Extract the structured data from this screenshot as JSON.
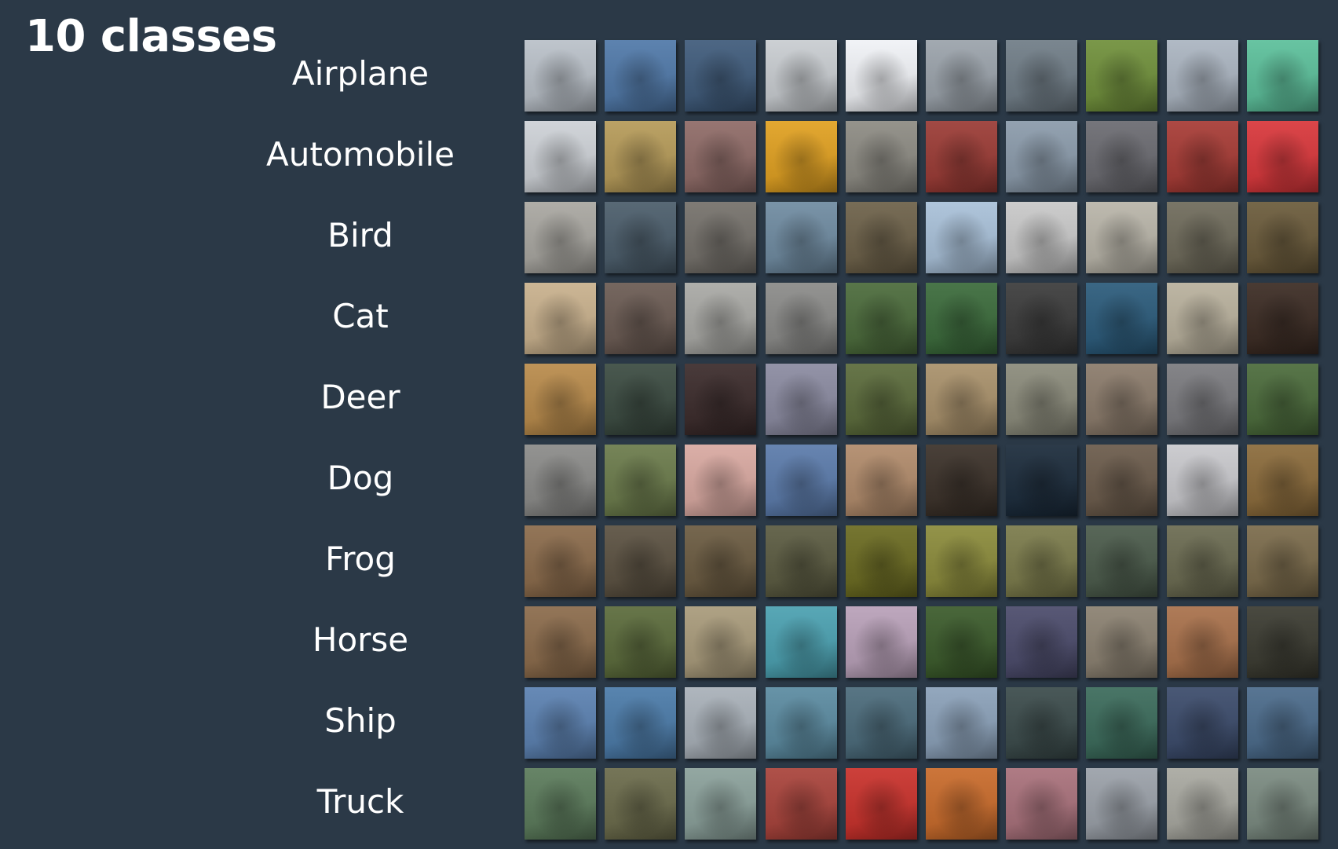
{
  "title": "10 classes",
  "classes": [
    {
      "label": "Airplane",
      "colors": [
        "#b9c0c8",
        "#4f78a8",
        "#3e5a7a",
        "#c8ccd0",
        "#f0f2f6",
        "#9aa2aa",
        "#6f7c86",
        "#6f8f3a",
        "#aab4c0",
        "#5bbf9a"
      ]
    },
    {
      "label": "Automobile",
      "colors": [
        "#cdd1d6",
        "#b59a58",
        "#8e6a66",
        "#e0a020",
        "#8c8a82",
        "#9a3a34",
        "#8a9aaa",
        "#6a6a70",
        "#a63a34",
        "#d8363a"
      ]
    },
    {
      "label": "Bird",
      "colors": [
        "#a8a6a0",
        "#4a5c6a",
        "#74706a",
        "#6e8aa0",
        "#6c6048",
        "#a8c0d8",
        "#c8c8c8",
        "#b8b4a8",
        "#6e6a5a",
        "#6a5a3a"
      ]
    },
    {
      "label": "Cat",
      "colors": [
        "#c8b08c",
        "#6a5a52",
        "#a8a8a4",
        "#8a8a88",
        "#4a6a3a",
        "#3a6a3a",
        "#3a3a3a",
        "#2a5a7a",
        "#b8b09c",
        "#3a2a22"
      ]
    },
    {
      "label": "Deer",
      "colors": [
        "#b88a4a",
        "#3a4a40",
        "#3a2a2a",
        "#8a8aa0",
        "#5a6a3a",
        "#a8906a",
        "#8a8a7a",
        "#8a7a6a",
        "#7a7a7e",
        "#4a6a3a"
      ]
    },
    {
      "label": "Dog",
      "colors": [
        "#8a8a88",
        "#6a7a4a",
        "#d8a8a0",
        "#5a7aaa",
        "#b08a6a",
        "#3a3028",
        "#1a2a3a",
        "#6a5a4a",
        "#c8c8cc",
        "#8a6a3a"
      ]
    },
    {
      "label": "Frog",
      "colors": [
        "#8a6a4a",
        "#5a5040",
        "#6a5a40",
        "#5a5a40",
        "#6a6a20",
        "#8a8a3a",
        "#7a7a4a",
        "#4a5a4a",
        "#6a6a50",
        "#7a6a4a"
      ]
    },
    {
      "label": "Horse",
      "colors": [
        "#8a6a4a",
        "#5a6a3a",
        "#a89a7a",
        "#4aa0b0",
        "#b8a0b8",
        "#3a5a2a",
        "#4a4a6a",
        "#8a8070",
        "#a8704a",
        "#3a3a30"
      ]
    },
    {
      "label": "Ship",
      "colors": [
        "#5a80b0",
        "#4a7aa8",
        "#a8b0b8",
        "#5a8aa0",
        "#4a6a7a",
        "#8aa0b8",
        "#3a4a4a",
        "#3a6a5a",
        "#3a4a6a",
        "#4a6a8a"
      ]
    },
    {
      "label": "Truck",
      "colors": [
        "#5a7a5a",
        "#6a6a4a",
        "#8aa09a",
        "#a8423a",
        "#c8302a",
        "#c86a2a",
        "#a8707a",
        "#9aa0a8",
        "#a8a8a0",
        "#7a8a80"
      ]
    }
  ]
}
